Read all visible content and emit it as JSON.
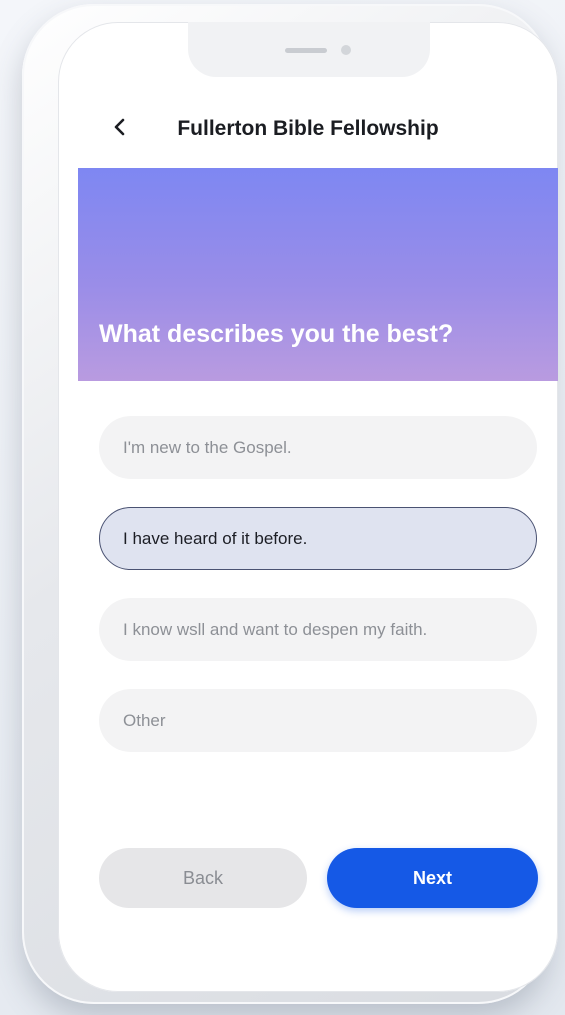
{
  "header": {
    "title": "Fullerton Bible Fellowship",
    "back_icon": "chevron-left-icon"
  },
  "hero": {
    "question": "What describes you the best?",
    "gradient_colors": [
      "#7e87f2",
      "#b99be0"
    ]
  },
  "options": [
    {
      "label": "I'm new to the Gospel.",
      "selected": false
    },
    {
      "label": "I have heard of it before.",
      "selected": true
    },
    {
      "label": "I know wsll and want to despen my faith.",
      "selected": false
    },
    {
      "label": "Other",
      "selected": false
    }
  ],
  "actions": {
    "back_label": "Back",
    "next_label": "Next",
    "next_color": "#1559e6"
  }
}
